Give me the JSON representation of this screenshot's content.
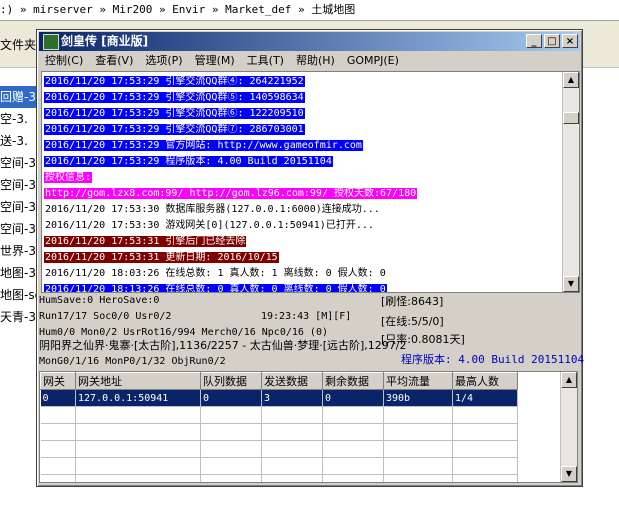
{
  "explorer": {
    "address": ":) » mirserver » Mir200 » Envir » Market_def » 土城地图",
    "folder_label": "文件夹",
    "files": [
      {
        "name": "回赠-3.",
        "selected": true
      },
      {
        "name": "空-3."
      },
      {
        "name": "送-3."
      },
      {
        "name": "空间-3."
      },
      {
        "name": "空间-3."
      },
      {
        "name": "空间-3."
      },
      {
        "name": "空间-3."
      },
      {
        "name": "世界-3."
      },
      {
        "name": "地图-3."
      },
      {
        "name": "地图-sc"
      },
      {
        "name": "天青-3."
      }
    ]
  },
  "window": {
    "title": "剑皇传 [商业版]",
    "buttons": {
      "minimize": "_",
      "maximize": "□",
      "close": "×"
    },
    "menu": [
      "控制(C)",
      "查看(V)",
      "选项(P)",
      "管理(M)",
      "工具(T)",
      "帮助(H)",
      "GOMPJ(E)"
    ]
  },
  "log": {
    "lines": [
      {
        "text": "2016/11/20 17:53:29 引擎交流QQ群④: 264221952",
        "bg": "#0000ff",
        "fg": "#ffffff"
      },
      {
        "text": "2016/11/20 17:53:29 引擎交流QQ群⑤: 140598634",
        "bg": "#0000ff",
        "fg": "#ffffff"
      },
      {
        "text": "2016/11/20 17:53:29 引擎交流QQ群⑥: 122209510",
        "bg": "#0000ff",
        "fg": "#ffffff"
      },
      {
        "text": "2016/11/20 17:53:29 引擎交流QQ群⑦: 286703001",
        "bg": "#0000ff",
        "fg": "#ffffff"
      },
      {
        "text": "2016/11/20 17:53:29 官方网站: http://www.gameofmir.com",
        "bg": "#0000ff",
        "fg": "#ffffff"
      },
      {
        "text": "2016/11/20 17:53:29 程序版本: 4.00 Build 20151104",
        "bg": "#0000ff",
        "fg": "#ffffff"
      },
      {
        "text": "授权信息:",
        "bg": "#ff00ff",
        "fg": "#ffffff"
      },
      {
        "text": "http://gom.lzx8.com:99/ http://gom.lz96.com:99/ 授权天数:67/180",
        "bg": "#ff00ff",
        "fg": "#ffffff"
      },
      {
        "text": "2016/11/20 17:53:30 数据库服务器(127.0.0.1:6000)连接成功...",
        "bg": "#ffffff",
        "fg": "#000000"
      },
      {
        "text": "2016/11/20 17:53:30 游戏网关[0](127.0.0.1:50941)已打开...",
        "bg": "#ffffff",
        "fg": "#000000"
      },
      {
        "text": "2016/11/20 17:53:31 引擎后门已经去除",
        "bg": "#800000",
        "fg": "#ffffff"
      },
      {
        "text": "2016/11/20 17:53:31 更新日期: 2016/10/15",
        "bg": "#800000",
        "fg": "#ffffff"
      },
      {
        "text": "2016/11/20 18:03:26 在线总数: 1 真人数: 1 离线数: 0 假人数: 0",
        "bg": "#ffffff",
        "fg": "#000000"
      },
      {
        "text": "2016/11/20 18:13:26 在线总数: 0 真人数: 0 离线数: 0 假人数: 0",
        "bg": "#0000ff",
        "fg": "#ffffff"
      }
    ]
  },
  "status": {
    "line1": "HumSave:0 HeroSave:0",
    "line2": "Run17/17 Soc0/0 Usr0/2",
    "time": "19:23:43 [M][F]",
    "line3": "Hum0/0 Mon0/2 UsrRot16/994 Merch0/16 Npc0/16 (0)",
    "line4": "阴阳界之仙界·鬼寨·[太古阶],1136/2257 - 太古仙兽·梦理·[远古阶],1297/2",
    "line5": "MonG0/1/16 MonP0/1/32 ObjRun0/2",
    "refresh": "[刷怪:8643]",
    "online": "[在线:5/5/0]",
    "ratio": "[只率:0.8081天]",
    "version": "程序版本: 4.00 Build 20151104",
    "version_color": "#0000c0"
  },
  "gateway_table": {
    "headers": [
      "网关",
      "网关地址",
      "队列数据",
      "发送数据",
      "剩余数据",
      "平均流量",
      "最高人数"
    ],
    "rows": [
      [
        "0",
        "127.0.0.1:50941",
        "0",
        "3",
        "0",
        "390b",
        "1/4"
      ]
    ]
  }
}
